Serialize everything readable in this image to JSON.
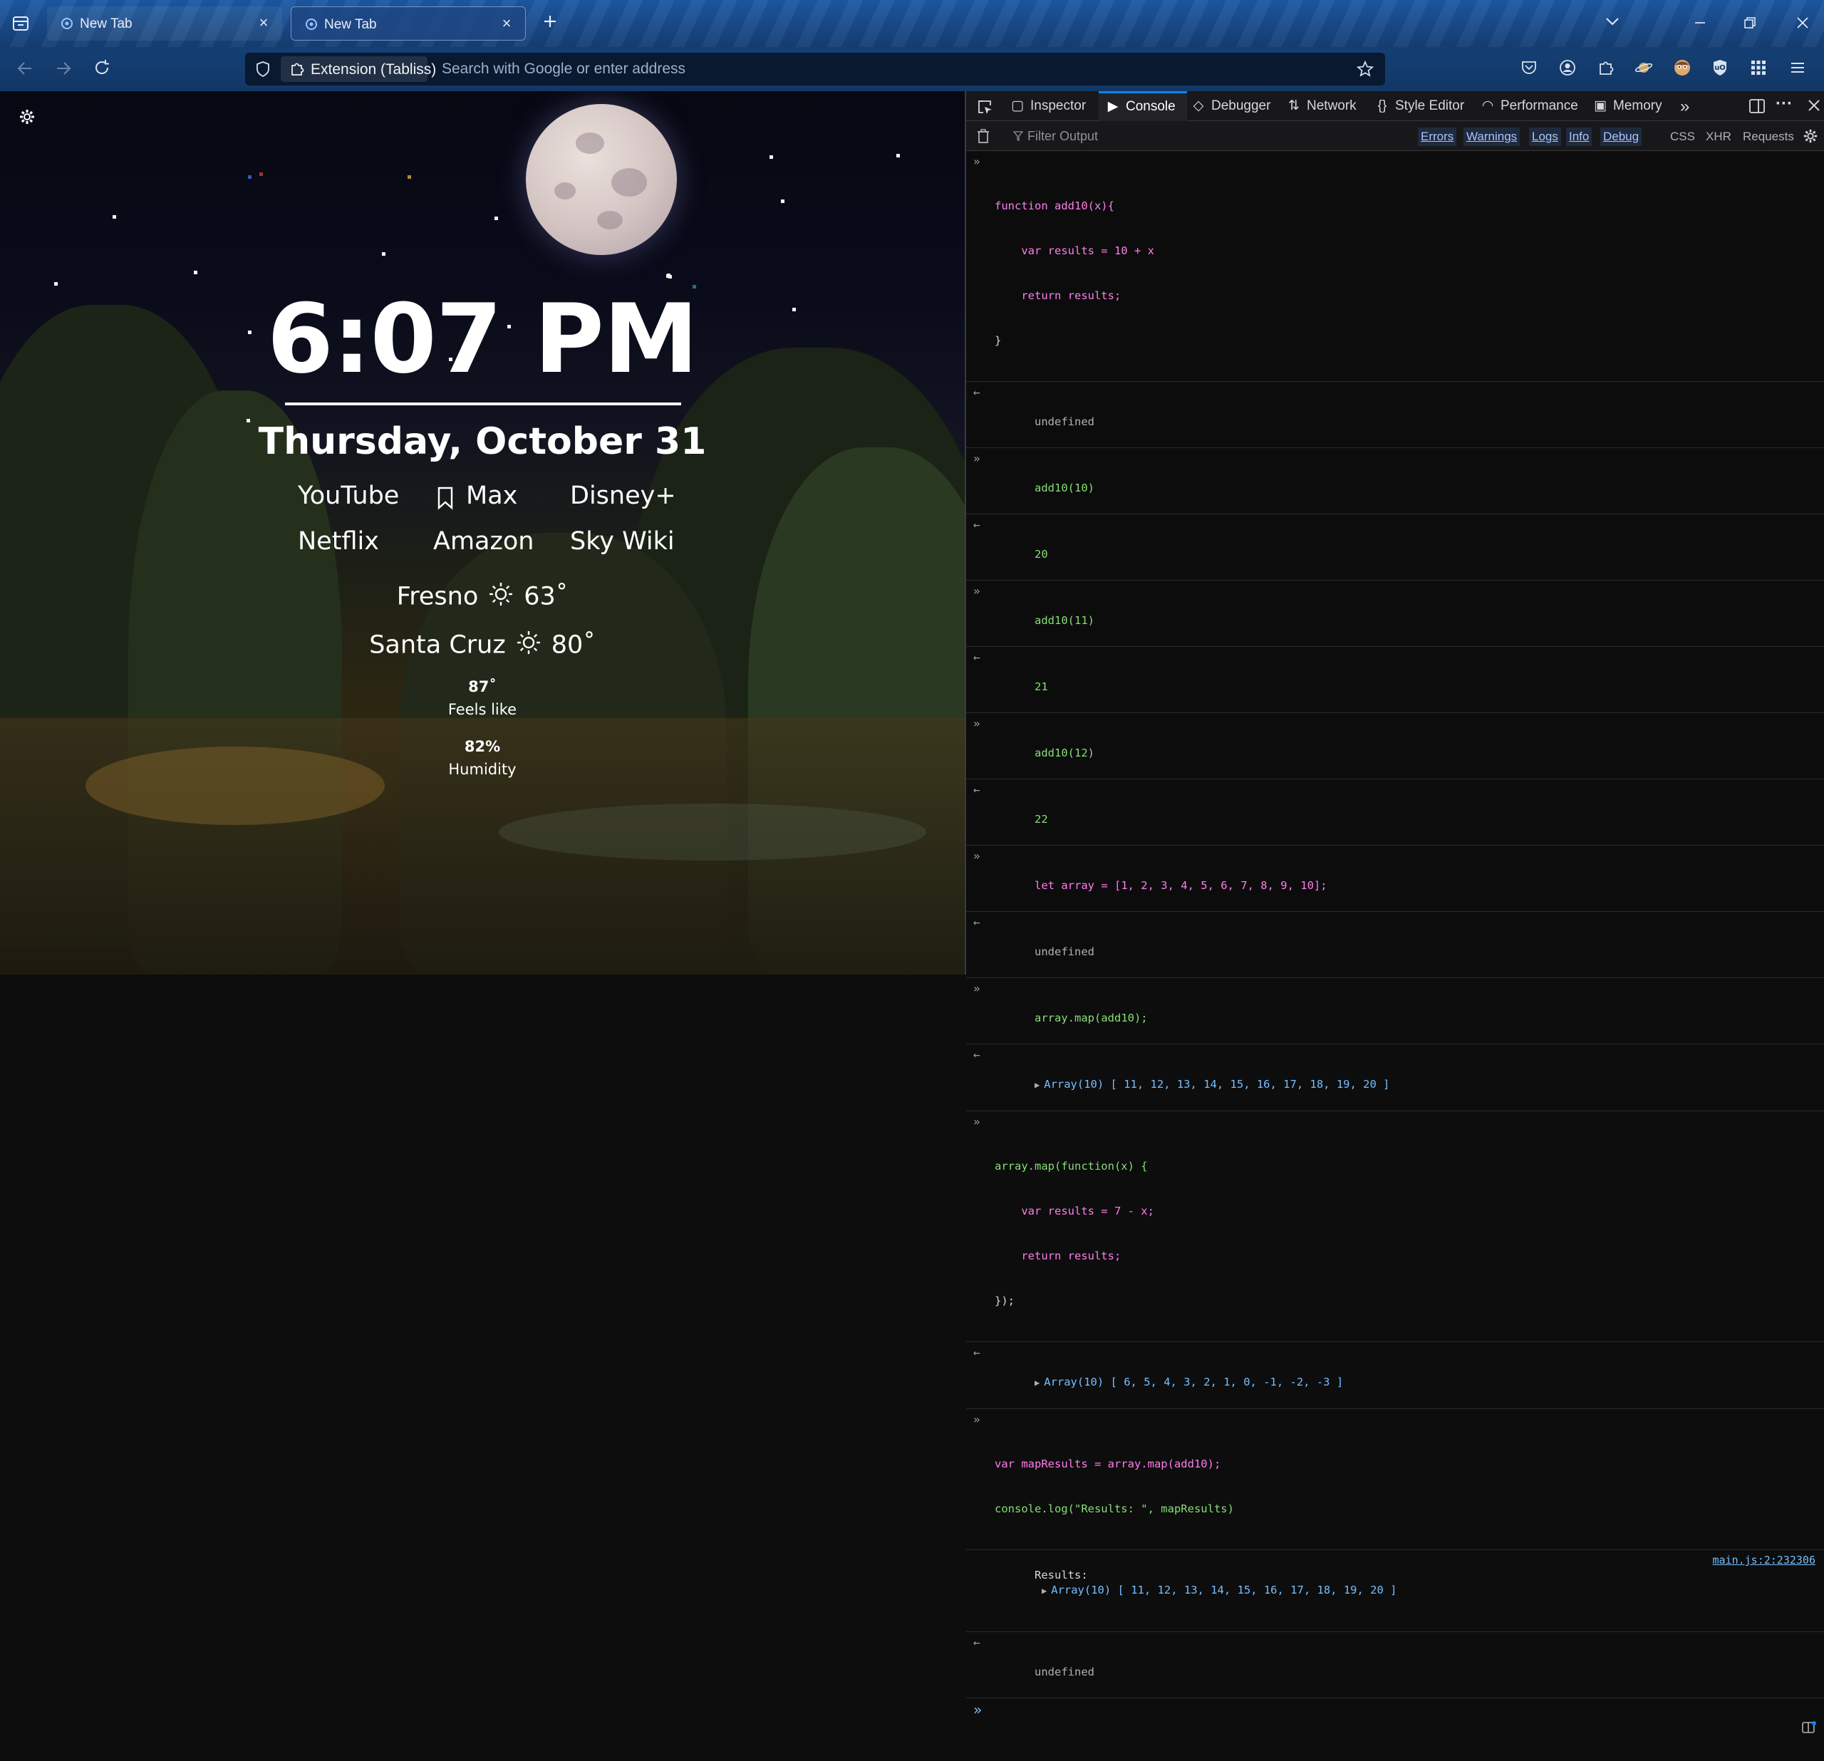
{
  "tabs": [
    {
      "title": "New Tab",
      "active": false
    },
    {
      "title": "New Tab",
      "active": true
    }
  ],
  "urlbar": {
    "extension_label": "Extension (Tabliss)",
    "placeholder": "Search with Google or enter address"
  },
  "ntp": {
    "time": "6:07 PM",
    "date": "Thursday, October 31",
    "links": [
      "YouTube",
      "Max",
      "Disney+",
      "Netflix",
      "Amazon",
      "Sky Wiki"
    ],
    "weather": [
      {
        "city": "Fresno",
        "temp": "63˚"
      },
      {
        "city": "Santa Cruz",
        "temp": "80˚"
      }
    ],
    "details": [
      {
        "value": "87˚",
        "label": "Feels like"
      },
      {
        "value": "82%",
        "label": "Humidity"
      }
    ]
  },
  "devtools": {
    "tabs": [
      "Inspector",
      "Console",
      "Debugger",
      "Network",
      "Style Editor",
      "Performance",
      "Memory"
    ],
    "active_tab": "Console",
    "filter_placeholder": "Filter Output",
    "filters_on": [
      "Errors",
      "Warnings",
      "Logs",
      "Info",
      "Debug"
    ],
    "filters_off": [
      "CSS",
      "XHR",
      "Requests"
    ],
    "console": {
      "e1": [
        "function add10(x){",
        "    var results = 10 + x",
        "    return results;",
        "}"
      ],
      "r1": "undefined",
      "e2": "add10(10)",
      "r2": "20",
      "e3": "add10(11)",
      "r3": "21",
      "e4": "add10(12)",
      "r4": "22",
      "e5": "let array = [1, 2, 3, 4, 5, 6, 7, 8, 9, 10];",
      "r5": "undefined",
      "e6": "array.map(add10);",
      "r6": "Array(10) [ 11, 12, 13, 14, 15, 16, 17, 18, 19, 20 ]",
      "e7": [
        "array.map(function(x) {",
        "    var results = 7 - x;",
        "    return results;",
        "});"
      ],
      "r7": "Array(10) [ 6, 5, 4, 3, 2, 1, 0, -1, -2, -3 ]",
      "e8": [
        "var mapResults = array.map(add10);",
        "console.log(\"Results: \", mapResults)"
      ],
      "log_label": "Results: ",
      "log_value": "Array(10) [ 11, 12, 13, 14, 15, 16, 17, 18, 19, 20 ]",
      "log_source": "main.js:2:232306",
      "r8": "undefined"
    }
  },
  "colors": {
    "accent": "#0a84ff",
    "console_keyword": "#ff7de9",
    "console_number": "#75bfff",
    "console_result": "#86de74"
  }
}
